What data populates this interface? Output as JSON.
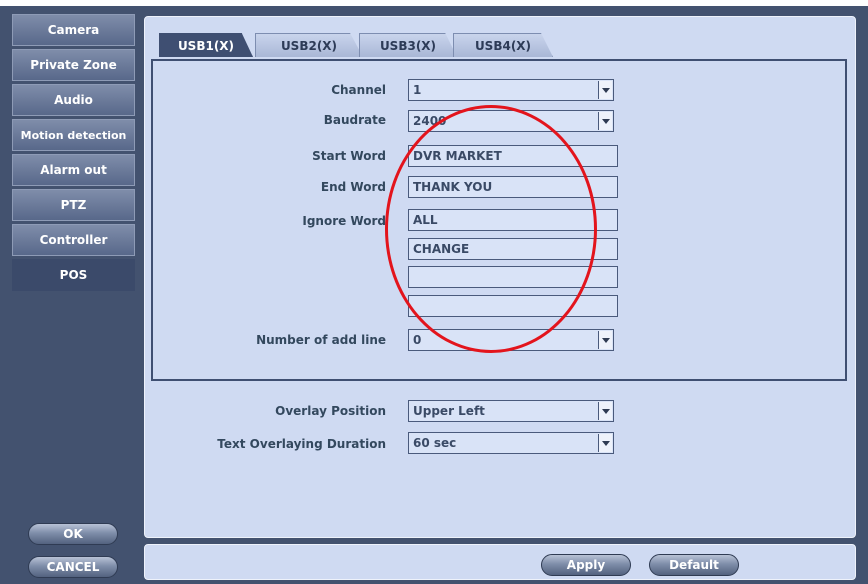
{
  "sidebar": {
    "items": [
      {
        "label": "Camera"
      },
      {
        "label": "Private Zone"
      },
      {
        "label": "Audio"
      },
      {
        "label": "Motion detection"
      },
      {
        "label": "Alarm out"
      },
      {
        "label": "PTZ"
      },
      {
        "label": "Controller"
      },
      {
        "label": "POS"
      }
    ],
    "active": "POS",
    "ok_label": "OK",
    "cancel_label": "CANCEL"
  },
  "tabs": [
    {
      "label": "USB1(X)"
    },
    {
      "label": "USB2(X)"
    },
    {
      "label": "USB3(X)"
    },
    {
      "label": "USB4(X)"
    }
  ],
  "form": {
    "channel": {
      "label": "Channel",
      "value": "1"
    },
    "baudrate": {
      "label": "Baudrate",
      "value": "2400"
    },
    "start_word": {
      "label": "Start Word",
      "value": "DVR MARKET"
    },
    "end_word": {
      "label": "End Word",
      "value": "THANK YOU"
    },
    "ignore_word": {
      "label": "Ignore Word",
      "values": [
        "ALL",
        "CHANGE",
        "",
        ""
      ]
    },
    "add_line": {
      "label": "Number of add line",
      "value": "0"
    },
    "overlay_position": {
      "label": "Overlay Position",
      "value": "Upper Left"
    },
    "overlay_duration": {
      "label": "Text Overlaying Duration",
      "value": "60 sec"
    }
  },
  "footer": {
    "apply_label": "Apply",
    "default_label": "Default"
  },
  "colors": {
    "frame": "#43526f",
    "panel": "#cfdaf2",
    "annotation": "#e3141c"
  }
}
